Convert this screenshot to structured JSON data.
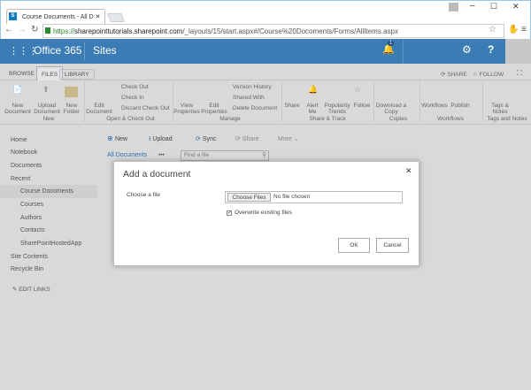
{
  "browser": {
    "tab_title": "Course Documents - All D",
    "url_secure": "https://",
    "url_host": "sharepointtutorials.sharepoint.com",
    "url_path": "/_layouts/15/start.aspx#/Course%20Docoments/Forms/AllItems.aspx"
  },
  "suite": {
    "app": "Office 365",
    "section": "Sites",
    "notification_count": "1"
  },
  "ribbon": {
    "tabs": [
      "BROWSE",
      "FILES",
      "LIBRARY"
    ],
    "share": "SHARE",
    "follow": "FOLLOW",
    "buttons": {
      "new_document": "New Document",
      "upload_document": "Upload Document",
      "new_folder": "New Folder",
      "edit_document": "Edit Document",
      "check_out": "Check Out",
      "check_in": "Check In",
      "discard_check_out": "Discard Check Out",
      "view_properties": "View Properties",
      "edit_properties": "Edit Properties",
      "version_history": "Version History",
      "shared_with": "Shared With",
      "delete_document": "Delete Document",
      "share": "Share",
      "alert_me": "Alert Me",
      "popularity_trends": "Popularity Trends",
      "follow": "Follow",
      "download_copy": "Download a Copy",
      "workflows": "Workflows",
      "publish": "Publish",
      "tags_notes": "Tags & Notes"
    },
    "groups": [
      "New",
      "Open & Check Out",
      "Manage",
      "Share & Track",
      "Copies",
      "Workflows",
      "Tags and Notes"
    ]
  },
  "nav": {
    "items": [
      "Home",
      "Notebook",
      "Documents",
      "Recent"
    ],
    "recent": [
      "Course Docoments",
      "Courses",
      "Authors",
      "Contacts",
      "SharePointHostedApp"
    ],
    "bottom": [
      "Site Contents",
      "Recycle Bin"
    ],
    "edit_links": "EDIT LINKS"
  },
  "toolbar": {
    "new": "New",
    "upload": "Upload",
    "sync": "Sync",
    "share": "Share",
    "more": "More",
    "view": "All Documents",
    "ellipsis": "•••",
    "search_placeholder": "Find a file"
  },
  "dialog": {
    "title": "Add a document",
    "choose_label": "Choose a file",
    "choose_button": "Choose Files",
    "no_file": "No file chosen",
    "overwrite": "Overwrite existing files",
    "overwrite_checked": true,
    "ok": "OK",
    "cancel": "Cancel"
  }
}
